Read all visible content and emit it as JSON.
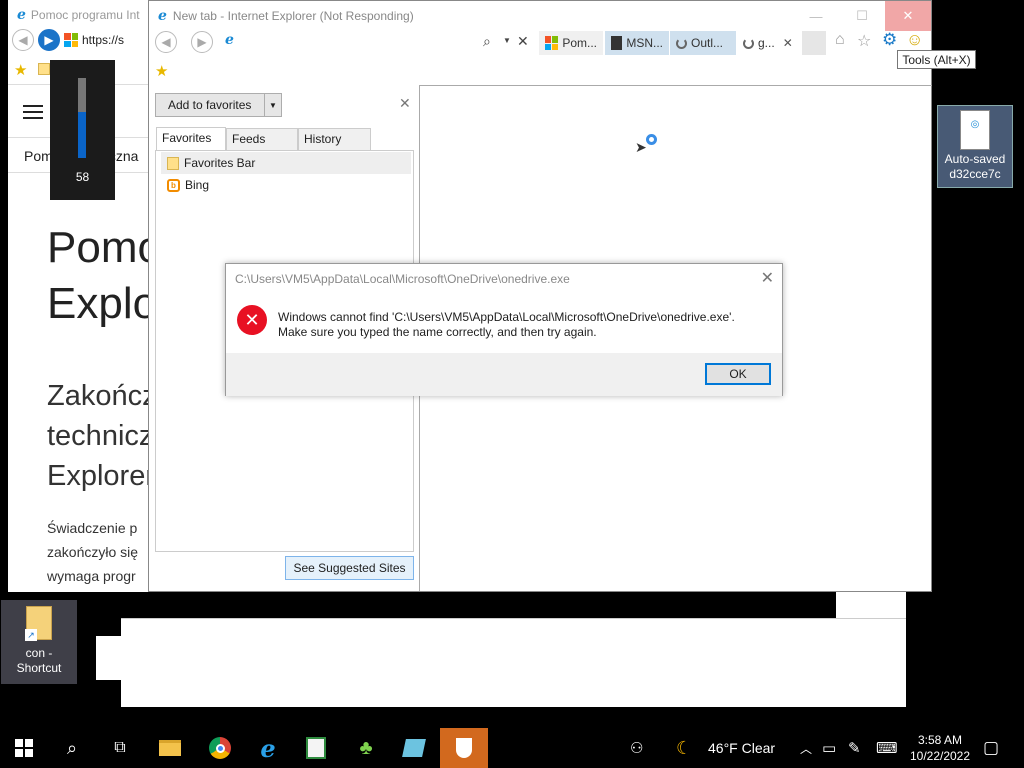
{
  "colors": {
    "accent": "#0078d7",
    "error": "#e81123",
    "close_hover": "#f1a7a7",
    "taskbar_active": "#d2691e"
  },
  "back_window": {
    "title": "Pomoc programu Int",
    "address": "https://s",
    "breadcrumb": "Pomoc techniczna",
    "heading": "Pomoc\nExplor",
    "subheading": "Zakończ\ntechnicz\nExplorer",
    "paragraph": "Świadczenie p\nzakończyło się\nwymaga progr"
  },
  "volume": {
    "level": 58,
    "label": "58"
  },
  "main_window": {
    "title": "New tab - Internet Explorer (Not Responding)",
    "controls": {
      "minimize": "—",
      "maximize": "☐",
      "close": "✕"
    },
    "tabs": [
      {
        "label": "Pom...",
        "icon": "ms-logo-icon"
      },
      {
        "label": "MSN...",
        "icon": "msn-icon"
      },
      {
        "label": "Outl...",
        "icon": "loading-icon"
      },
      {
        "label": "g...",
        "icon": "loading-icon"
      }
    ],
    "tab_close": "✕"
  },
  "favorites_pane": {
    "add_label": "Add to favorites",
    "close": "✕",
    "tabs": [
      "Favorites",
      "Feeds",
      "History"
    ],
    "items": [
      {
        "label": "Favorites Bar",
        "icon": "folder-icon"
      },
      {
        "label": "Bing",
        "icon": "bing-icon"
      }
    ],
    "suggest_label": "See Suggested Sites"
  },
  "dialog": {
    "title": "C:\\Users\\VM5\\AppData\\Local\\Microsoft\\OneDrive\\onedrive.exe",
    "message": "Windows cannot find 'C:\\Users\\VM5\\AppData\\Local\\Microsoft\\OneDrive\\onedrive.exe'.\nMake sure you typed the name correctly, and then try again.",
    "ok_label": "OK",
    "close": "✕"
  },
  "tooltip": "Tools (Alt+X)",
  "desktop_icons": [
    {
      "label": "Auto-saved\nd32cce7c",
      "icon": "document-icon"
    },
    {
      "label": "con -\nShortcut",
      "icon": "folder-shortcut-icon"
    }
  ],
  "taskbar": {
    "weather": "46°F  Clear",
    "time": "3:58 AM",
    "date": "10/22/2022"
  }
}
